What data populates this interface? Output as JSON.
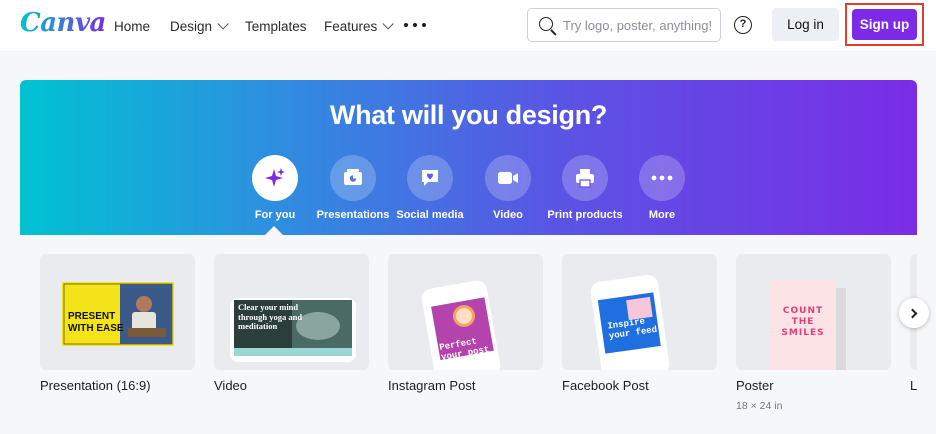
{
  "logo": "Canva",
  "nav": {
    "home": "Home",
    "design": "Design",
    "templates": "Templates",
    "features": "Features"
  },
  "search": {
    "placeholder": "Try logo, poster, anything!"
  },
  "help": "?",
  "auth": {
    "login": "Log in",
    "signup": "Sign up"
  },
  "hero": {
    "title": "What will you design?",
    "categories": [
      {
        "label": "For you",
        "icon": "sparkle-icon",
        "active": true
      },
      {
        "label": "Presentations",
        "icon": "presentation-icon"
      },
      {
        "label": "Social media",
        "icon": "heart-chat-icon"
      },
      {
        "label": "Video",
        "icon": "video-camera-icon"
      },
      {
        "label": "Print products",
        "icon": "printer-icon"
      },
      {
        "label": "More",
        "icon": "more-dots-icon"
      }
    ]
  },
  "templates": [
    {
      "label": "Presentation (16:9)",
      "thumb_text": "PRESENT WITH EASE"
    },
    {
      "label": "Video",
      "thumb_text": "Clear your mind through yoga and meditation"
    },
    {
      "label": "Instagram Post",
      "thumb_text": "Perfect your post"
    },
    {
      "label": "Facebook Post",
      "thumb_text": "Inspire your feed"
    },
    {
      "label": "Poster",
      "sub": "18 × 24 in",
      "thumb_text": "COUNT THE SMILES"
    },
    {
      "label": "L"
    }
  ],
  "colors": {
    "brand": "#7d2ae8",
    "signup_highlight": "#e0402f"
  }
}
